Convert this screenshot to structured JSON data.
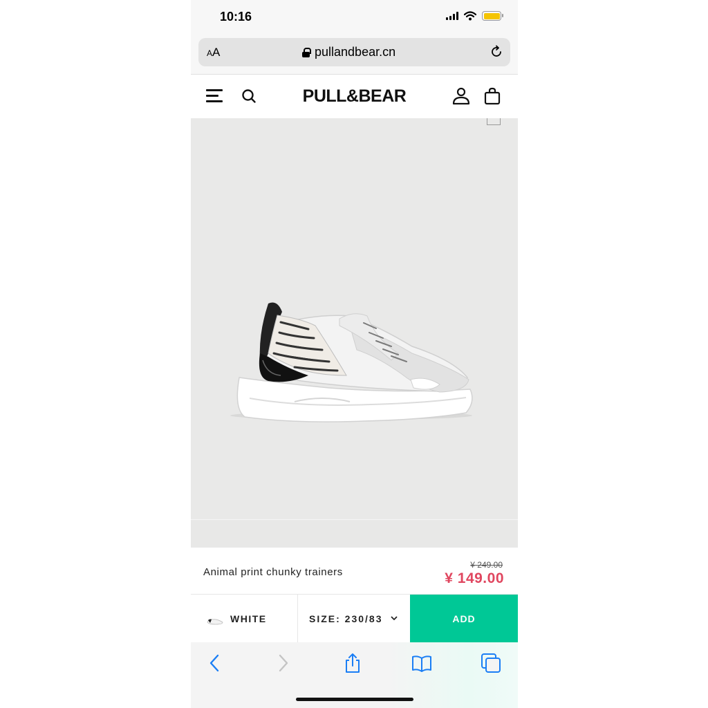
{
  "status_bar": {
    "time": "10:16",
    "battery_color": "#f5c400"
  },
  "browser": {
    "text_size_label": "AA",
    "url": "pullandbear.cn"
  },
  "site": {
    "brand": "PULL&BEAR"
  },
  "product": {
    "name": "Animal print chunky trainers",
    "old_price": "¥ 249.00",
    "price": "¥ 149.00",
    "color": "WHITE",
    "size": "SIZE: 230/83",
    "add_label": "ADD"
  },
  "colors": {
    "accent": "#00c896",
    "price": "#e0465f",
    "ios_blue": "#1a7ef5"
  },
  "icons": [
    "lock-icon",
    "reload-icon",
    "menu-icon",
    "search-icon",
    "user-icon",
    "bag-icon",
    "chevron-down-icon",
    "back-icon",
    "forward-icon",
    "share-icon",
    "bookmarks-icon",
    "tabs-icon"
  ]
}
